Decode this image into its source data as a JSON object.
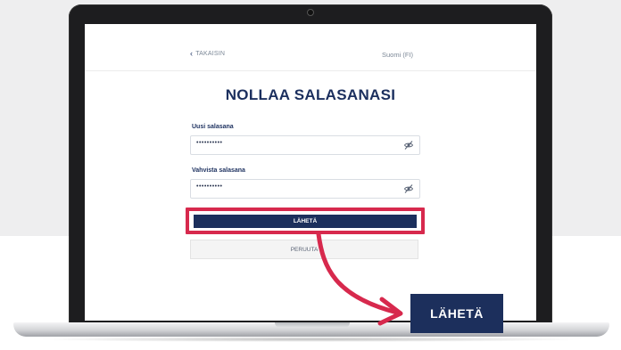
{
  "screen": {
    "back_label": "TAKAISIN",
    "language_label": "Suomi (FI)",
    "title": "NOLLAA SALASANASI",
    "new_password": {
      "label": "Uusi salasana",
      "value": "••••••••••"
    },
    "confirm_password": {
      "label": "Vahvista salasana",
      "value": "••••••••••"
    },
    "submit_label": "LÄHETÄ",
    "cancel_label": "PERUUTA"
  },
  "callout": {
    "label": "LÄHETÄ"
  },
  "colors": {
    "navy": "#1c2f5c",
    "highlight_red": "#d7294d"
  },
  "icons": [
    "chevron-left-icon",
    "eye-slash-icon",
    "curved-arrow-icon"
  ]
}
